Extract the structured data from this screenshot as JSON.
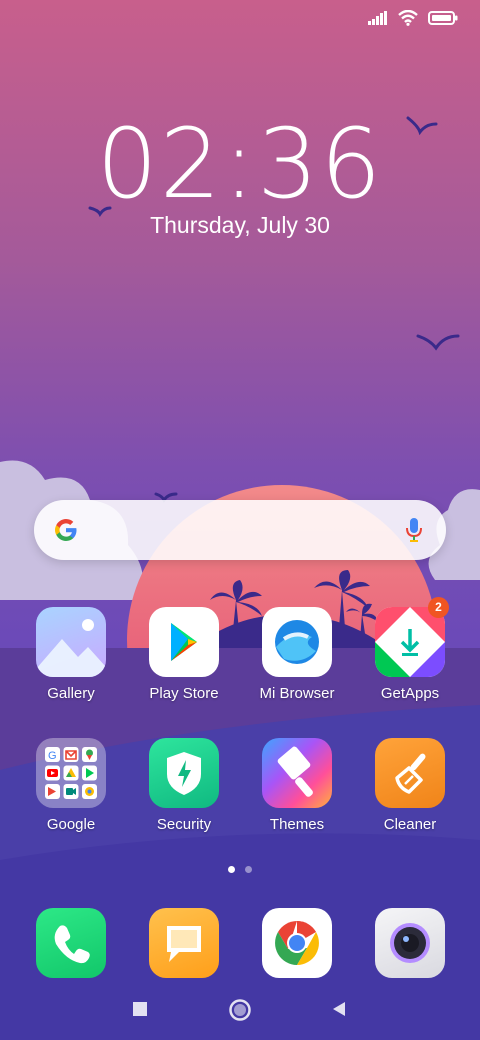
{
  "status_bar": {
    "icons": [
      "signal-icon",
      "wifi-icon",
      "battery-icon"
    ]
  },
  "clock": {
    "time": "02:36",
    "date": "Thursday, July 30"
  },
  "search": {
    "engine_icon": "google-g-icon",
    "mic_icon": "mic-icon"
  },
  "apps_row1": [
    {
      "label": "Gallery"
    },
    {
      "label": "Play Store"
    },
    {
      "label": "Mi Browser"
    },
    {
      "label": "GetApps",
      "badge": "2"
    }
  ],
  "apps_row2": [
    {
      "label": "Google"
    },
    {
      "label": "Security"
    },
    {
      "label": "Themes"
    },
    {
      "label": "Cleaner"
    }
  ],
  "dock": [
    {
      "icon": "phone-icon"
    },
    {
      "icon": "messages-icon"
    },
    {
      "icon": "chrome-icon"
    },
    {
      "icon": "camera-icon"
    }
  ],
  "page_indicator": {
    "pages": 2,
    "current": 1
  },
  "nav": {
    "icons": [
      "recents-square-icon",
      "home-circle-icon",
      "back-triangle-icon"
    ]
  },
  "colors": {
    "accent_badge": "#f05523",
    "sky_top": "#c85f8c",
    "sky_bottom": "#5f49b0"
  }
}
